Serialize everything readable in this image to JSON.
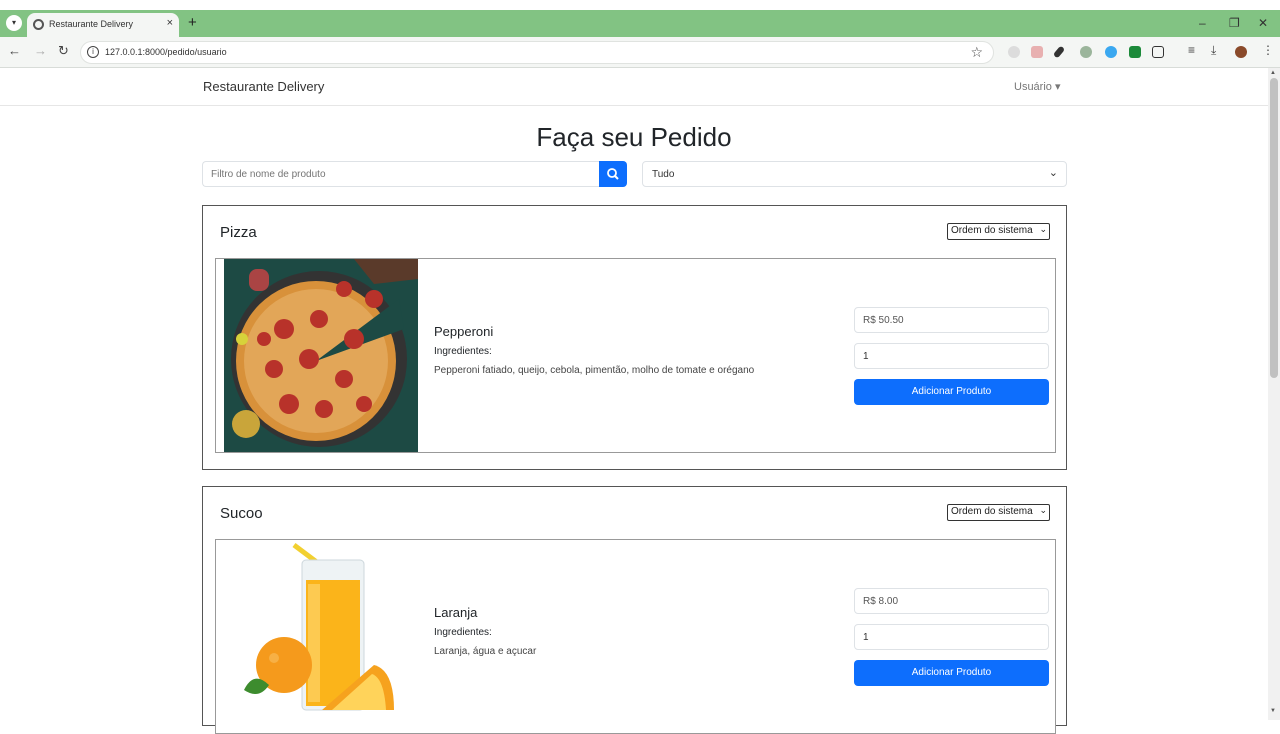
{
  "browser": {
    "tab_title": "Restaurante Delivery",
    "url": "127.0.0.1:8000/pedido/usuario",
    "new_tab": "+",
    "close_tab": "×",
    "minimize": "–",
    "restore": "❐",
    "close_window": "✕"
  },
  "nav": {
    "brand": "Restaurante Delivery",
    "user_menu": "Usuário ▾"
  },
  "page": {
    "title": "Faça seu Pedido",
    "search_placeholder": "Filtro de nome de produto",
    "filter_value": "Tudo"
  },
  "categories": [
    {
      "title": "Pizza",
      "sort_value": "Ordem do sistema",
      "product": {
        "name": "Pepperoni",
        "ingredients_label": "Ingredientes:",
        "ingredients": "Pepperoni fatiado, queijo, cebola, pimentão, molho de tomate e orégano",
        "price": "R$ 50.50",
        "quantity": "1",
        "add_label": "Adicionar Produto"
      }
    },
    {
      "title": "Sucoo",
      "sort_value": "Ordem do sistema",
      "product": {
        "name": "Laranja",
        "ingredients_label": "Ingredientes:",
        "ingredients": "Laranja, água e açucar",
        "price": "R$ 8.00",
        "quantity": "1",
        "add_label": "Adicionar Produto"
      }
    }
  ],
  "colors": {
    "tabstrip": "#82c383",
    "primary": "#0d6efd"
  }
}
